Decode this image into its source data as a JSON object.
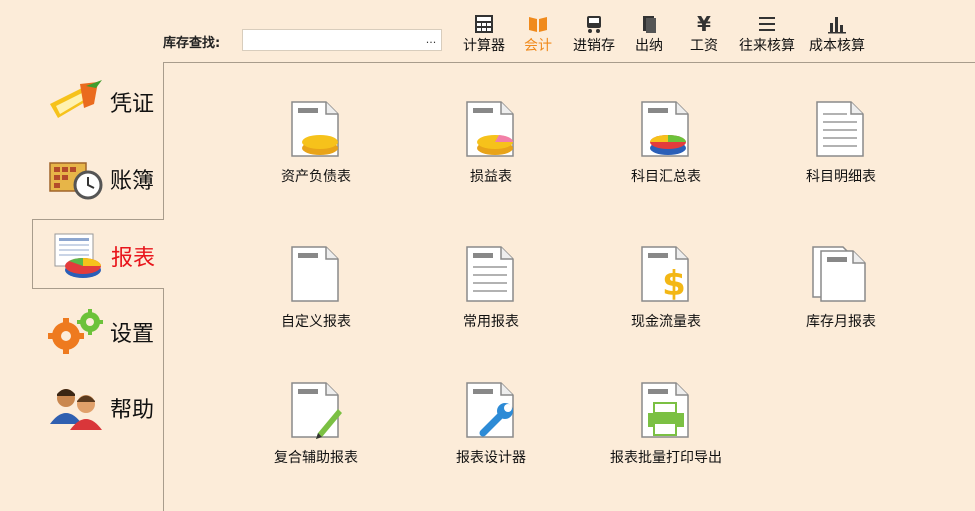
{
  "search": {
    "label": "库存查找:",
    "value": "",
    "button": "..."
  },
  "toolbar": [
    {
      "label": "计算器",
      "icon": "calculator-icon"
    },
    {
      "label": "会计",
      "icon": "book-icon",
      "active": true
    },
    {
      "label": "进销存",
      "icon": "cart-icon"
    },
    {
      "label": "出纳",
      "icon": "cashier-icon"
    },
    {
      "label": "工资",
      "icon": "yen-icon"
    },
    {
      "label": "往来核算",
      "icon": "list-icon"
    },
    {
      "label": "成本核算",
      "icon": "bar-chart-icon"
    }
  ],
  "nav": [
    {
      "label": "凭证",
      "icon": "voucher-icon"
    },
    {
      "label": "账簿",
      "icon": "ledger-clock-icon"
    },
    {
      "label": "报表",
      "icon": "report-pie-icon",
      "active": true
    },
    {
      "label": "设置",
      "icon": "gears-icon"
    },
    {
      "label": "帮助",
      "icon": "users-help-icon"
    }
  ],
  "reports": [
    {
      "label": "资产负债表",
      "icon": "balance-sheet-icon"
    },
    {
      "label": "损益表",
      "icon": "income-statement-icon"
    },
    {
      "label": "科目汇总表",
      "icon": "account-summary-icon"
    },
    {
      "label": "科目明细表",
      "icon": "account-detail-icon"
    },
    {
      "label": "自定义报表",
      "icon": "custom-report-icon"
    },
    {
      "label": "常用报表",
      "icon": "common-report-icon"
    },
    {
      "label": "现金流量表",
      "icon": "cash-flow-icon"
    },
    {
      "label": "库存月报表",
      "icon": "inventory-monthly-icon"
    },
    {
      "label": "复合辅助报表",
      "icon": "compound-report-icon"
    },
    {
      "label": "报表设计器",
      "icon": "report-designer-icon"
    },
    {
      "label": "报表批量打印导出",
      "icon": "batch-print-icon"
    }
  ],
  "colors": {
    "background": "#fcecd9",
    "active_nav": "#e8141b",
    "active_tool": "#f08a1c"
  }
}
